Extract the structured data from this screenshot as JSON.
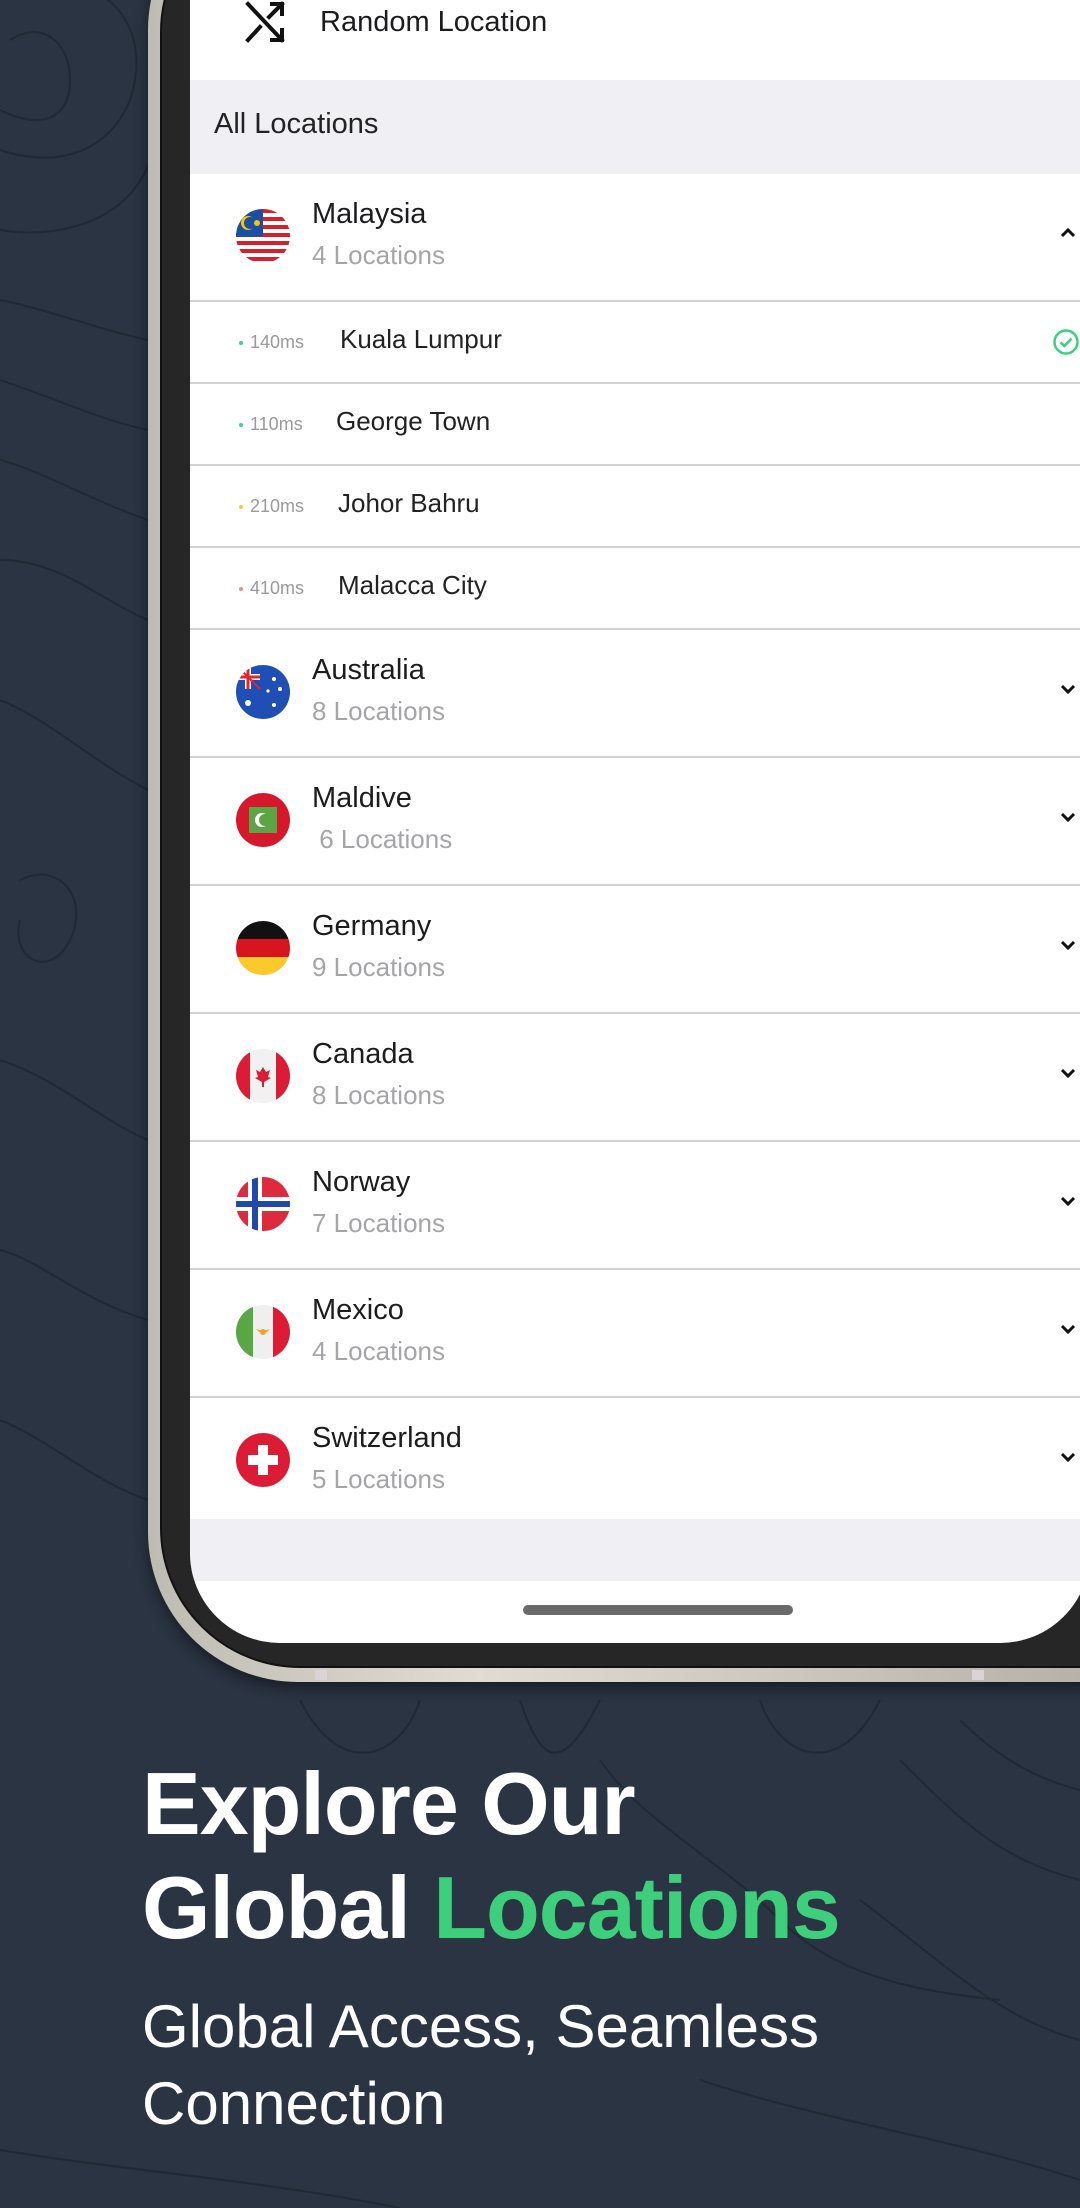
{
  "screen": {
    "random_location_label": "Random Location",
    "section_header": "All Locations",
    "countries": [
      {
        "name": "Malaysia",
        "count": "4 Locations",
        "flag": "malaysia-flag",
        "expanded": true,
        "cities": [
          {
            "ping": "140ms",
            "name": "Kuala Lumpur",
            "status": "green",
            "selected": true
          },
          {
            "ping": "110ms",
            "name": "George Town",
            "status": "green",
            "selected": false
          },
          {
            "ping": "210ms",
            "name": "Johor Bahru",
            "status": "yellow",
            "selected": false
          },
          {
            "ping": "410ms",
            "name": "Malacca City",
            "status": "red",
            "selected": false
          }
        ]
      },
      {
        "name": "Australia",
        "count": "8 Locations",
        "flag": "australia-flag",
        "expanded": false
      },
      {
        "name": "Maldive",
        "count": " 6 Locations",
        "flag": "maldives-flag",
        "expanded": false
      },
      {
        "name": "Germany",
        "count": "9 Locations",
        "flag": "germany-flag",
        "expanded": false
      },
      {
        "name": "Canada",
        "count": "8 Locations",
        "flag": "canada-flag",
        "expanded": false
      },
      {
        "name": "Norway",
        "count": "7 Locations",
        "flag": "norway-flag",
        "expanded": false
      },
      {
        "name": "Mexico",
        "count": "4 Locations",
        "flag": "mexico-flag",
        "expanded": false
      },
      {
        "name": "Switzerland",
        "count": "5 Locations",
        "flag": "switzerland-flag",
        "expanded": false
      }
    ]
  },
  "marketing": {
    "headline_line1": "Explore Our",
    "headline_line2_plain": "Global ",
    "headline_line2_accent": "Locations",
    "subheadline_line1": "Global Access, Seamless",
    "subheadline_line2": "Connection"
  },
  "colors": {
    "background": "#2a3442",
    "accent": "#3ecf7c",
    "ping_good": "#3ecf9a",
    "ping_medium": "#f5c542",
    "ping_bad": "#f08a8a",
    "check": "#3ecf7c"
  }
}
